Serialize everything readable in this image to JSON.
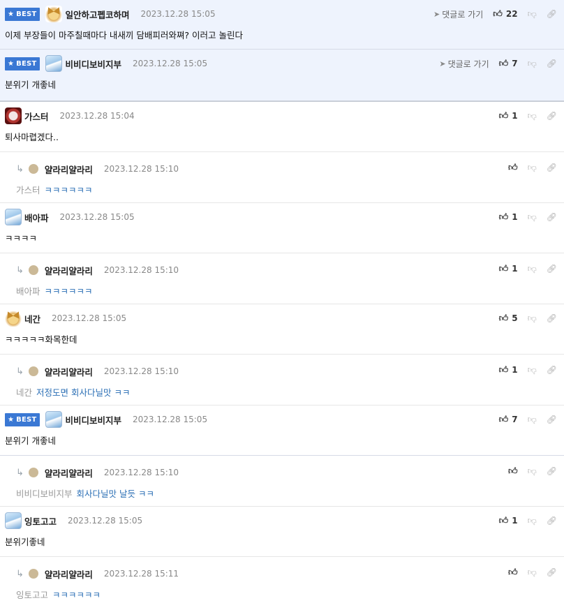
{
  "best_label": "BEST",
  "goto_label": "댓글로 가기",
  "comments": [
    {
      "best": true,
      "nick": "일안하고펩코하며",
      "date": "2023.12.28 15:05",
      "text": "이제 부장들이 마주칠때마다 내새끼 담배피러와쪄? 이러고 놀린다",
      "likes": "22",
      "avatar": "dog"
    },
    {
      "best": true,
      "nick": "비비디보비지부",
      "date": "2023.12.28 15:05",
      "text": "분위기 개좋네",
      "likes": "7",
      "avatar": "ice"
    },
    {
      "nick": "가스터",
      "date": "2023.12.28 15:04",
      "text": "퇴사마렵겠다..",
      "likes": "1",
      "avatar": "red"
    },
    {
      "reply": true,
      "nick": "얄라리얄라리",
      "date": "2023.12.28 15:10",
      "mention": "가스터",
      "text": "ㅋㅋㅋㅋㅋㅋ",
      "likes": ""
    },
    {
      "nick": "배아파",
      "date": "2023.12.28 15:05",
      "text": "ㅋㅋㅋㅋ",
      "likes": "1",
      "avatar": "ice"
    },
    {
      "reply": true,
      "nick": "얄라리얄라리",
      "date": "2023.12.28 15:10",
      "mention": "배아파",
      "text": "ㅋㅋㅋㅋㅋㅋ",
      "likes": "1"
    },
    {
      "nick": "네간",
      "date": "2023.12.28 15:05",
      "text": "ㅋㅋㅋㅋㅋ화목한데",
      "likes": "5",
      "avatar": "dog"
    },
    {
      "reply": true,
      "nick": "얄라리얄라리",
      "date": "2023.12.28 15:10",
      "mention": "네간",
      "text": "저정도면 회사다닐맛 ㅋㅋ",
      "likes": "1"
    },
    {
      "best": true,
      "nick": "비비디보비지부",
      "date": "2023.12.28 15:05",
      "text": "분위기 개좋네",
      "likes": "7",
      "avatar": "ice"
    },
    {
      "reply": true,
      "nick": "얄라리얄라리",
      "date": "2023.12.28 15:10",
      "mention": "비비디보비지부",
      "text": "회사다닐맛 날듯 ㅋㅋ",
      "likes": ""
    },
    {
      "nick": "잉토고고",
      "date": "2023.12.28 15:05",
      "text": "분위기좋네",
      "likes": "1",
      "avatar": "ice"
    },
    {
      "reply": true,
      "nick": "얄라리얄라리",
      "date": "2023.12.28 15:11",
      "mention": "잉토고고",
      "text": "ㅋㅋㅋㅋㅋㅋ",
      "likes": ""
    }
  ]
}
